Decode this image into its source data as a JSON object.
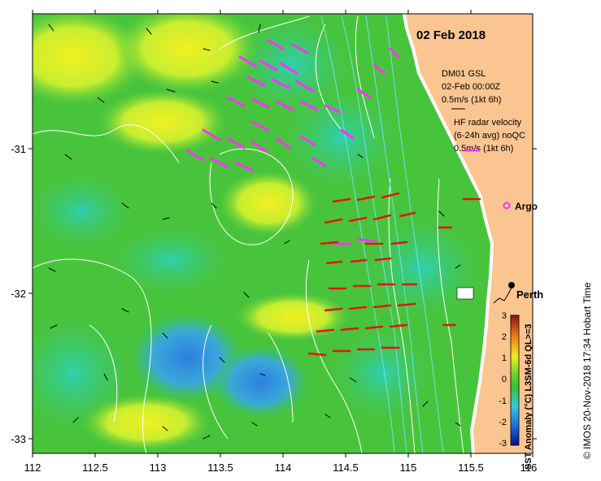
{
  "title": "02 Feb 2018",
  "labels": {
    "legend_gsl_title": "DM01 GSL",
    "legend_gsl_time": "02-Feb 00:00Z",
    "legend_gsl_scale": "0.5m/s (1kt 6h)",
    "legend_hf_title": "HF radar velocity",
    "legend_hf_avg": "(6-24h avg) noQC",
    "legend_hf_scale": "0.5m/s (1kt 6h)",
    "argo_label": "Argo",
    "city_label": "Perth",
    "colorbar_label": "SST Anomaly (°C) L3SM-6d QL>=3",
    "credit": "© IMOS 20-Nov-2018 17:34 Hobart Time"
  },
  "axes": {
    "x_ticks": [
      "112",
      "112.5",
      "113",
      "113.5",
      "114",
      "114.5",
      "115",
      "115.5",
      "116"
    ],
    "y_ticks": [
      "-31",
      "-32",
      "-33"
    ],
    "x_range": [
      112,
      116
    ],
    "y_range": [
      -33.1,
      -30.1
    ]
  },
  "colorbar": {
    "ticks": [
      "3",
      "2",
      "1",
      "0",
      "-1",
      "-2",
      "-3"
    ],
    "range": [
      -3,
      3
    ]
  },
  "colors": {
    "land": "#fbc591",
    "hf_vectors": "#ff33ff",
    "current_vectors": "#e0180e",
    "drifter_vectors": "#000000",
    "contours": "#ffffff",
    "isobaths": "#66e0e0",
    "argo_marker": "#ff33ff"
  }
}
